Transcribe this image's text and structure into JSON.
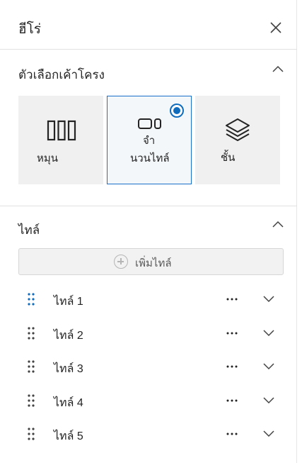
{
  "header": {
    "title": "ฮีโร่"
  },
  "layout_section": {
    "title": "ตัวเลือกเค้าโครง",
    "options": [
      {
        "label": "หมุน",
        "icon": "columns-icon",
        "selected": false
      },
      {
        "label_line1": "จำ",
        "label_line2": "นวนไทล์",
        "icon": "tiles-icon",
        "selected": true
      },
      {
        "label": "ชั้น",
        "icon": "layers-icon",
        "selected": false
      }
    ]
  },
  "tiles_section": {
    "title": "ไทล์",
    "add_label": "เพิ่มไทล์",
    "tiles": [
      {
        "name": "ไทล์ 1",
        "active": true
      },
      {
        "name": "ไทล์ 2",
        "active": false
      },
      {
        "name": "ไทล์ 3",
        "active": false
      },
      {
        "name": "ไทล์ 4",
        "active": false
      },
      {
        "name": "ไทล์ 5",
        "active": false
      }
    ]
  },
  "colors": {
    "accent": "#0f6cbd",
    "card_bg": "#f0f0f0",
    "text": "#242424"
  }
}
